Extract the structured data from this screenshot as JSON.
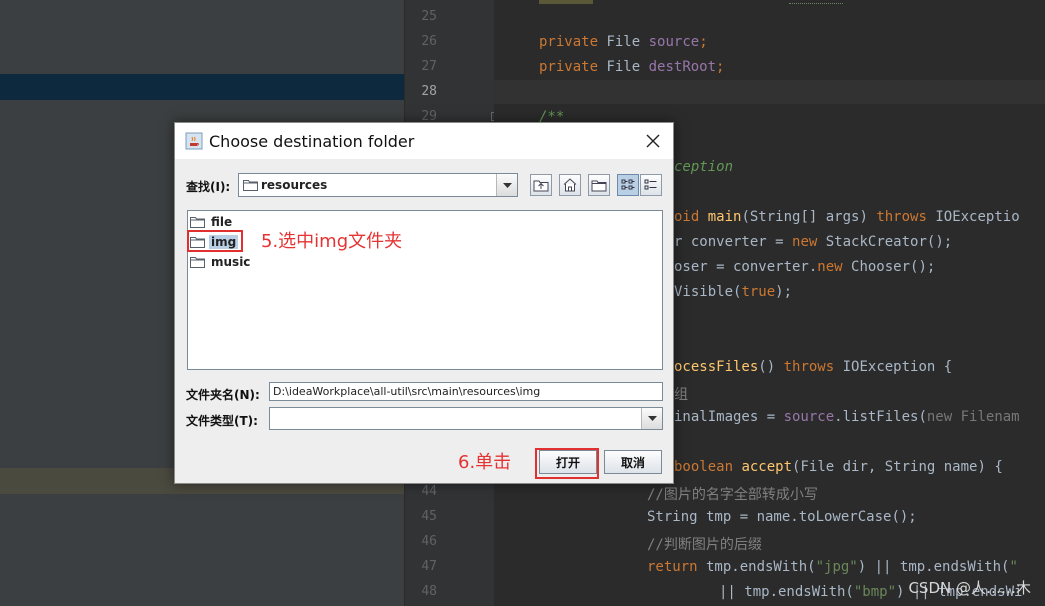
{
  "dialog": {
    "title": "Choose destination folder",
    "look_in_label": "查找(I):",
    "look_in_value": "resources",
    "folder_name_label": "文件夹名(N):",
    "folder_name_value": "D:\\ideaWorkplace\\all-util\\src\\main\\resources\\img",
    "file_type_label": "文件类型(T):",
    "file_type_value": "",
    "files": [
      {
        "name": "file",
        "selected": false
      },
      {
        "name": "img",
        "selected": true
      },
      {
        "name": "music",
        "selected": false
      }
    ],
    "open_label": "打开",
    "cancel_label": "取消",
    "toolbar_icons": [
      "up-folder-icon",
      "home-icon",
      "new-folder-icon",
      "list-view-icon",
      "details-view-icon"
    ]
  },
  "annotations": {
    "step5": "5.选中img文件夹",
    "step6": "6.单击"
  },
  "editor": {
    "line_numbers": [
      "25",
      "26",
      "27",
      "28",
      "29",
      "44",
      "45",
      "46",
      "47",
      "48"
    ],
    "lines": {
      "l26": [
        "private",
        "File",
        "source",
        ";"
      ],
      "l27": [
        "private",
        "File",
        "destRoot",
        ";"
      ],
      "l29": "/**",
      "l31": "ception",
      "l33_a": "oid",
      "l33_b": "main",
      "l33_c": "(String[] args)",
      "l33_d": "throws",
      "l33_e": "IOExceptio",
      "l34_a": "r converter = ",
      "l34_b": "new",
      "l34_c": " StackCreator();",
      "l35_a": "oser = converter.",
      "l35_b": "new",
      "l35_c": " Chooser();",
      "l36_a": "Visible(",
      "l36_b": "true",
      "l36_c": ");",
      "l39_a": "ocessFiles",
      "l39_b": "() ",
      "l39_c": "throws",
      "l39_d": " IOException {",
      "l40": "组",
      "l41_a": "inalImages = ",
      "l41_b": "source",
      "l41_c": ".listFiles(",
      "l41_d": "new",
      "l41_e": " Filenam",
      "l43_a": "boolean",
      "l43_b": "accept",
      "l43_c": "(File dir, String name) {",
      "l44": "//图片的名字全部转成小写",
      "l45_a": "String tmp = name.",
      "l45_b": "toLowerCase",
      "l45_c": "();",
      "l46": "//判断图片的后缀",
      "l47_a": "return",
      "l47_b": " tmp.endsWith(",
      "l47_c": "\"jpg\"",
      "l47_d": ") || tmp.endsWith(",
      "l47_e": "\"",
      "l48_a": "|| tmp.endsWith(",
      "l48_b": "\"bmp\"",
      "l48_c": ") || tmp.endsWi"
    }
  },
  "watermark": "CSDN @人……木"
}
